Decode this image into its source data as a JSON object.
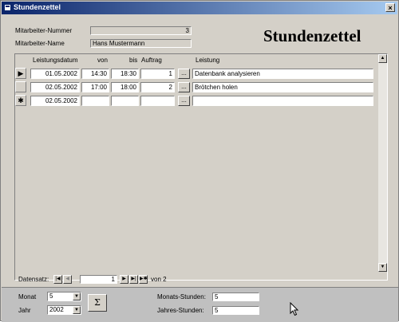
{
  "window": {
    "title": "Stundenzettel",
    "close_glyph": "×"
  },
  "header": {
    "nummer_label": "Mitarbeiter-Nummer",
    "nummer_value": "3",
    "name_label": "Mitarbeiter-Name",
    "name_value": "Hans Mustermann",
    "big_title": "Stundenzettel"
  },
  "grid": {
    "columns": [
      "Leistungsdatum",
      "von",
      "bis",
      "Auftrag",
      "Leistung"
    ],
    "rows": [
      {
        "selector": "▶",
        "datum": "01.05.2002",
        "von": "14:30",
        "bis": "18:30",
        "auftrag": "1",
        "leistung": "Datenbank analysieren"
      },
      {
        "selector": "",
        "datum": "02.05.2002",
        "von": "17:00",
        "bis": "18:00",
        "auftrag": "2",
        "leistung": "Brötchen holen"
      },
      {
        "selector": "✱",
        "datum": "02.05.2002",
        "von": "",
        "bis": "",
        "auftrag": "",
        "leistung": ""
      }
    ],
    "dots_label": "...",
    "scroll_up": "▲",
    "scroll_down": "▼"
  },
  "navigation": {
    "label": "Datensatz:",
    "first": "|◀",
    "prev": "◀",
    "current": "1",
    "next": "▶",
    "last": "▶|",
    "new": "▶✱",
    "of_text": "von  2"
  },
  "footer": {
    "monat_label": "Monat",
    "monat_value": "5",
    "jahr_label": "Jahr",
    "jahr_value": "2002",
    "sigma_label": "Σ",
    "monats_label": "Monats-Stunden:",
    "monats_value": "5",
    "jahres_label": "Jahres-Stunden:",
    "jahres_value": "5",
    "dropdown_arrow": "▼"
  }
}
